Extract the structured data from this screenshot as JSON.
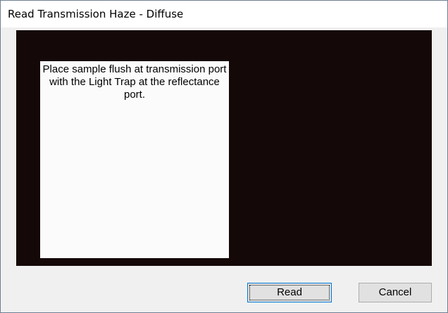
{
  "window": {
    "title": "Read Transmission Haze - Diffuse"
  },
  "instruction": {
    "text": "Place sample flush at transmission port with the Light Trap at the reflectance port."
  },
  "buttons": {
    "read_label": "Read",
    "cancel_label": "Cancel"
  },
  "colors": {
    "display_background": "#140809",
    "card_background": "#fbfbfb",
    "focus_border": "#0078d7"
  }
}
